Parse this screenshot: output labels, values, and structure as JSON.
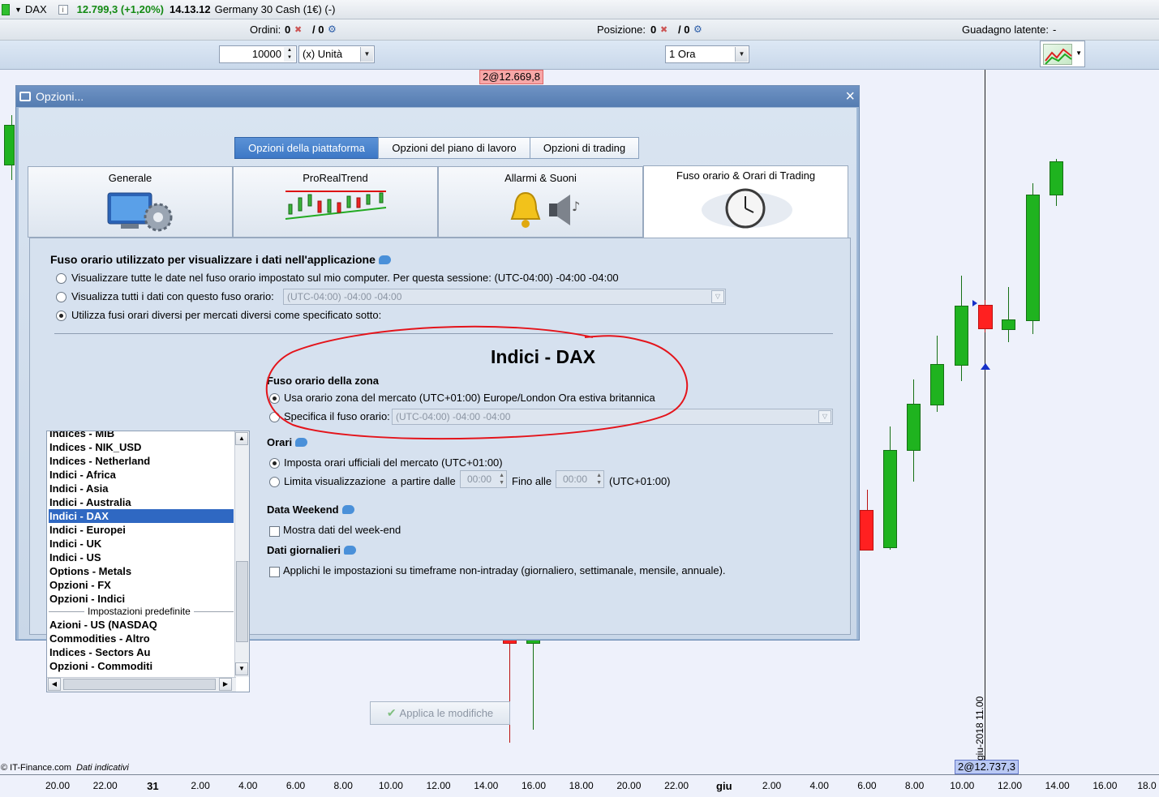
{
  "topbar": {
    "symbol": "DAX",
    "price": "12.799,3 (+1,20%)",
    "time": "14.13.12",
    "instrument": "Germany 30 Cash (1€) (-)"
  },
  "orders": {
    "ordini_label": "Ordini:",
    "ordini_value": "0",
    "ordini_total": "/ 0",
    "posizione_label": "Posizione:",
    "posizione_value": "0",
    "posizione_total": "/ 0",
    "guadagno_label": "Guadagno latente:",
    "guadagno_value": "-"
  },
  "controls": {
    "quantity": "10000",
    "unit": "(x) Unità",
    "timeframe": "1 Ora"
  },
  "chart": {
    "price_top_label": "2@12.669,8",
    "price_bottom_label": "2@12.737,3",
    "vertical_date_label": "giu-2018 11.00",
    "source_label": "© IT-Finance.com",
    "source_note": "Dati indicativi",
    "x_ticks": [
      "20.00",
      "22.00",
      "31",
      "2.00",
      "4.00",
      "6.00",
      "8.00",
      "10.00",
      "12.00",
      "14.00",
      "16.00",
      "18.00",
      "20.00",
      "22.00",
      "giu",
      "2.00",
      "4.00",
      "6.00",
      "8.00",
      "10.00",
      "12.00",
      "14.00",
      "16.00",
      "18.0"
    ],
    "colors": {
      "up": "#1fb31f",
      "down": "#ff2020"
    }
  },
  "dialog": {
    "title": "Opzioni...",
    "top_tabs": [
      "Opzioni della piattaforma",
      "Opzioni del piano di lavoro",
      "Opzioni di trading"
    ],
    "big_tabs": [
      "Generale",
      "ProRealTrend",
      "Allarmi & Suoni",
      "Fuso orario & Orari di Trading"
    ],
    "tz_heading": "Fuso orario utilizzato per visualizzare i dati nell'applicazione",
    "tz_opt1": "Visualizzare tutte le date nel fuso orario impostato sul mio computer. Per questa sessione: (UTC-04:00) -04:00 -04:00",
    "tz_opt2": "Visualizza tutti i dati con questo fuso orario:",
    "tz_opt2_value": "(UTC-04:00) -04:00 -04:00",
    "tz_opt3": "Utilizza fusi orari diversi per mercati diversi come specificato sotto:",
    "list_items": [
      "Indices - MIB",
      "Indices - NIK_USD",
      "Indices - Netherland",
      "Indici - Africa",
      "Indici - Asia",
      "Indici - Australia",
      "Indici - DAX",
      "Indici - Europei",
      "Indici - UK",
      "Indici - US",
      "Options - Metals",
      "Opzioni - FX",
      "Opzioni - Indici"
    ],
    "list_separator": "Impostazioni predefinite",
    "list_items2": [
      "Azioni - US (NASDAQ",
      "Commodities - Altro",
      "Indices - Sectors Au",
      "Opzioni - Commoditi"
    ],
    "market_title": "Indici - DAX",
    "zone_heading": "Fuso orario della zona",
    "zone_opt1": "Usa orario zona del mercato (UTC+01:00) Europe/London Ora estiva britannica",
    "zone_opt2": "Specifica il fuso orario:",
    "zone_opt2_value": "(UTC-04:00) -04:00 -04:00",
    "orari_heading": "Orari",
    "orari_opt1": "Imposta orari ufficiali del mercato  (UTC+01:00)",
    "orari_opt2": "Limita visualizzazione",
    "orari_from": "a partire dalle",
    "orari_from_value": "00:00",
    "orari_to": "Fino alle",
    "orari_to_value": "00:00",
    "orari_tz": "(UTC+01:00)",
    "weekend_heading": "Data Weekend",
    "weekend_opt": "Mostra dati del week-end",
    "daily_heading": "Dati giornalieri",
    "daily_opt": "Applichi le impostazioni su timeframe non-intraday (giornaliero, settimanale, mensile, annuale).",
    "apply_button": "Applica le modifiche"
  }
}
